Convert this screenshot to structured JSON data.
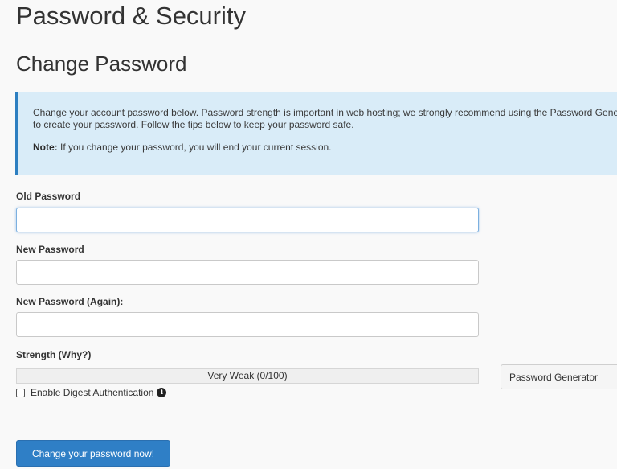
{
  "page": {
    "title": "Password & Security",
    "section_title": "Change Password"
  },
  "info": {
    "description": "Change your account password below. Password strength is important in web hosting; we strongly recommend using the Password Generator to create your password. Follow the tips below to keep your password safe.",
    "note_label": "Note:",
    "note_text": " If you change your password, you will end your current session."
  },
  "form": {
    "old_password": {
      "label": "Old Password",
      "value": "",
      "focused": true
    },
    "new_password": {
      "label": "New Password",
      "value": ""
    },
    "new_password_again": {
      "label": "New Password (Again):",
      "value": ""
    },
    "strength": {
      "label": "Strength (Why?)",
      "text": "Very Weak (0/100)",
      "score": 0,
      "max": 100
    },
    "generator_button": "Password Generator",
    "digest": {
      "label": "Enable Digest Authentication",
      "checked": false,
      "icon": "info-circle-icon"
    },
    "submit_button": "Change your password now!"
  },
  "colors": {
    "info_background": "#d9ecf8",
    "info_border": "#2d7fc1",
    "primary_button": "#2f7fc6",
    "focus_border": "#7cb0e0"
  }
}
